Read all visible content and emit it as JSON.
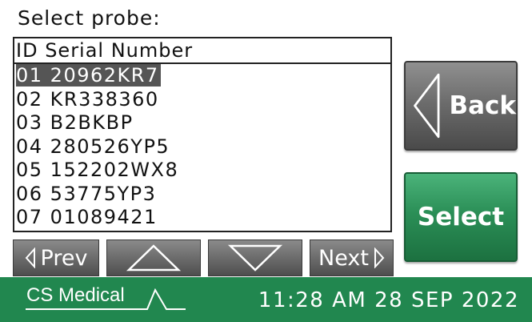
{
  "title": "Select probe:",
  "list": {
    "header": "ID Serial Number",
    "rows": [
      {
        "text": "01 20962KR7",
        "selected": true
      },
      {
        "text": "02 KR338360"
      },
      {
        "text": "03 B2BKBP"
      },
      {
        "text": "04 280526YP5"
      },
      {
        "text": "05 152202WX8"
      },
      {
        "text": "06 53775YP3"
      },
      {
        "text": "07 01089421"
      }
    ]
  },
  "nav": {
    "prev_label": "Prev",
    "next_label": "Next",
    "up_icon": "triangle-up-icon",
    "down_icon": "triangle-down-icon"
  },
  "buttons": {
    "back_label": "Back",
    "select_label": "Select"
  },
  "footer": {
    "brand": "CS Medical",
    "time": "11:28 AM 28 SEP 2022"
  },
  "colors": {
    "accent_green": "#21874f",
    "button_gray": "#6d6d6d",
    "selection": "#555555"
  }
}
